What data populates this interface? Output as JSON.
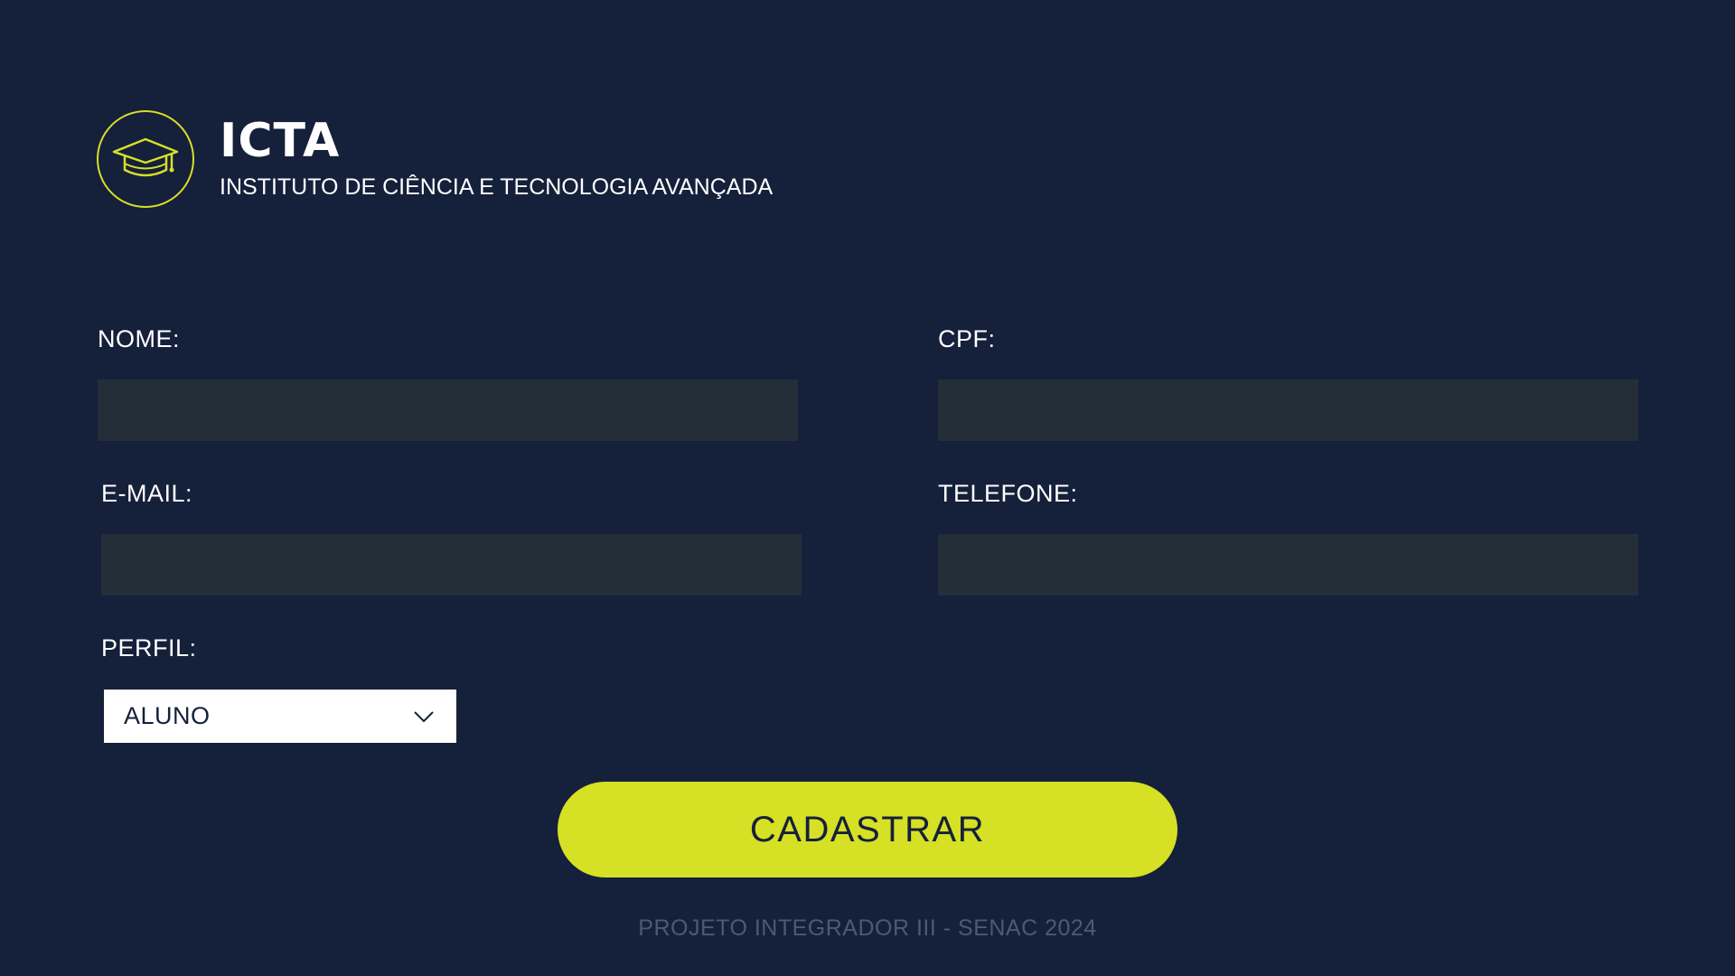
{
  "header": {
    "logo_icon": "graduation-cap-icon",
    "brand_name": "ICTA",
    "brand_subtitle": "INSTITUTO DE CIÊNCIA E TECNOLOGIA AVANÇADA"
  },
  "form": {
    "nome": {
      "label": "NOME:",
      "value": ""
    },
    "cpf": {
      "label": "CPF:",
      "value": ""
    },
    "email": {
      "label": "E-MAIL:",
      "value": ""
    },
    "telefone": {
      "label": "TELEFONE:",
      "value": ""
    },
    "perfil": {
      "label": "PERFIL:",
      "selected": "ALUNO",
      "icon": "chevron-down-icon"
    },
    "submit_label": "CADASTRAR"
  },
  "footer": {
    "text": "PROJETO INTEGRADOR III - SENAC 2024"
  },
  "colors": {
    "background": "#15203b",
    "input_background": "#232e39",
    "accent": "#d6e024",
    "footer_text": "#4f5a6d"
  }
}
